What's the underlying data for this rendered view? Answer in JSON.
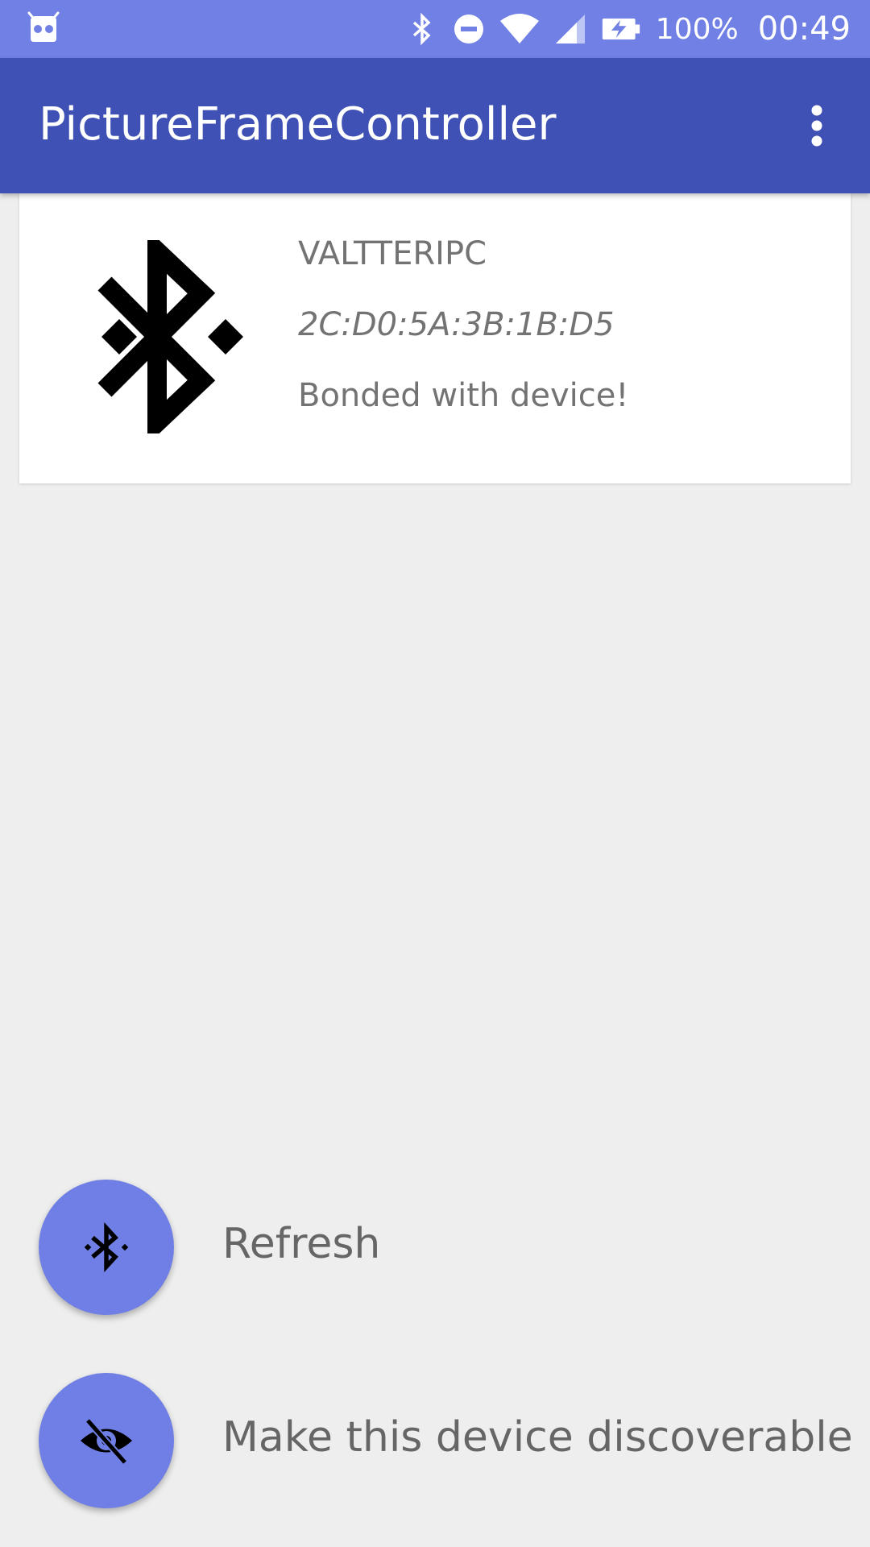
{
  "status_bar": {
    "icons": [
      "android-robot-icon",
      "bluetooth-icon",
      "do-not-disturb-icon",
      "wifi-icon",
      "cell-signal-icon",
      "battery-charging-icon"
    ],
    "battery_percent": "100%",
    "time": "00:49"
  },
  "app_bar": {
    "title": "PictureFrameController",
    "overflow_icon": "more-vert-icon"
  },
  "device_list": [
    {
      "icon": "bluetooth-icon",
      "name": "VALTTERIPC",
      "address": "2C:D0:5A:3B:1B:D5",
      "status": "Bonded with device!"
    }
  ],
  "actions": {
    "refresh": {
      "icon": "bluetooth-searching-icon",
      "label": "Refresh"
    },
    "discoverable": {
      "icon": "visibility-off-icon",
      "label": "Make this device discoverable"
    }
  },
  "colors": {
    "status_bar": "#7080e4",
    "app_bar": "#3f51b5",
    "fab": "#6f7fe6",
    "background": "#eeeeee",
    "card": "#ffffff",
    "secondary_text": "#737373"
  }
}
